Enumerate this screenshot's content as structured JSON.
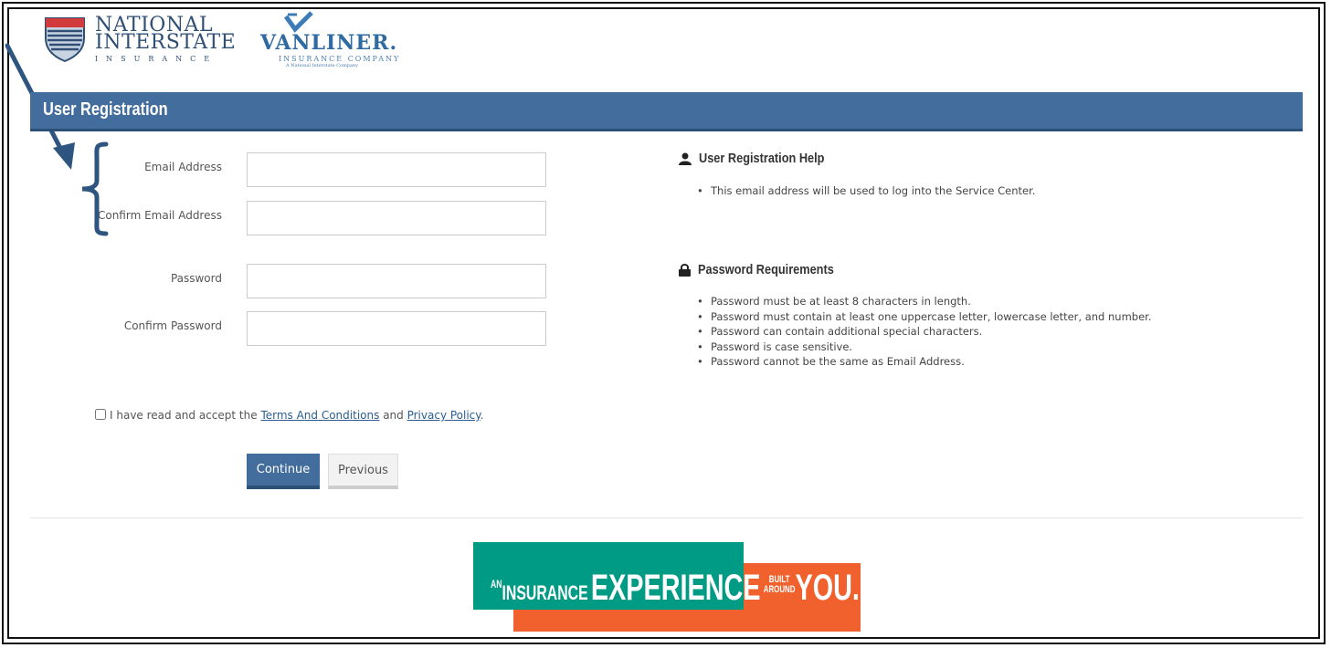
{
  "brand": {
    "ni_line1": "NATIONAL",
    "ni_line2": "INTERSTATE",
    "ni_line3": "INSURANCE",
    "vanliner_name": "VANLINER.",
    "vanliner_sub": "INSURANCE COMPANY",
    "vanliner_tag": "A National Interstate Company"
  },
  "header": {
    "title": "User Registration"
  },
  "form": {
    "email_label": "Email Address",
    "email_value": "",
    "confirm_email_label": "Confirm Email Address",
    "confirm_email_value": "",
    "password_label": "Password",
    "password_value": "",
    "confirm_password_label": "Confirm Password",
    "confirm_password_value": ""
  },
  "help": {
    "title": "User Registration Help",
    "items": [
      "This email address will be used to log into the Service Center."
    ]
  },
  "password_req": {
    "title": "Password Requirements",
    "items": [
      "Password must be at least 8 characters in length.",
      "Password must contain at least one uppercase letter, lowercase letter, and number.",
      "Password can contain additional special characters.",
      "Password is case sensitive.",
      "Password cannot be the same as Email Address."
    ]
  },
  "terms": {
    "checked": false,
    "prefix": "I have read and accept the",
    "terms_link": "Terms And Conditions",
    "middle": "and",
    "privacy_link": "Privacy Policy",
    "suffix": "."
  },
  "buttons": {
    "continue": "Continue",
    "previous": "Previous"
  },
  "banner": {
    "an": "AN",
    "insurance": "INSURANCE",
    "experience": "EXPERIENCE",
    "built": "BUILT",
    "around": "AROUND",
    "you": "YOU."
  },
  "colors": {
    "header": "#436d9c",
    "annotation": "#2e5580",
    "banner_teal": "#009b84",
    "banner_orange": "#f0612e"
  }
}
